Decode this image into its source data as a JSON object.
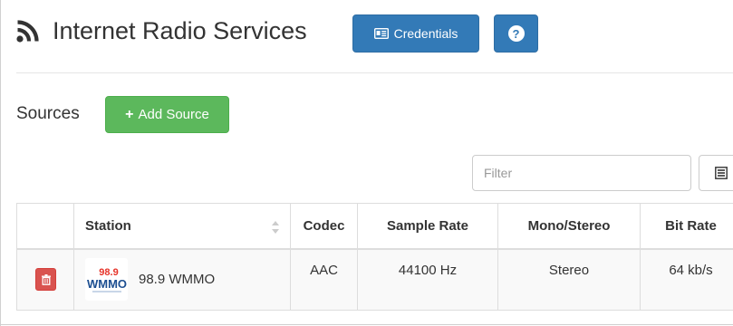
{
  "header": {
    "title": "Internet Radio Services",
    "credentials_label": "Credentials",
    "help_label": "?"
  },
  "sources": {
    "heading": "Sources",
    "add_label": "Add Source",
    "filter_placeholder": "Filter"
  },
  "table": {
    "columns": [
      "",
      "Station",
      "Codec",
      "Sample Rate",
      "Mono/Stereo",
      "Bit Rate"
    ],
    "rows": [
      {
        "station": "98.9 WMMO",
        "logo_text": "WMMO",
        "logo_freq": "98.9",
        "codec": "AAC",
        "sample_rate": "44100 Hz",
        "channels": "Stereo",
        "bit_rate": "64 kb/s"
      }
    ]
  },
  "colors": {
    "primary": "#337ab7",
    "success": "#5cb85c",
    "danger": "#d9534f"
  },
  "icons": {
    "title": "rss-icon",
    "credentials": "id-card-icon",
    "help": "question-circle-icon",
    "add": "plus-icon",
    "columns": "columns-list-icon",
    "sort": "sort-icon",
    "delete": "trash-icon"
  }
}
